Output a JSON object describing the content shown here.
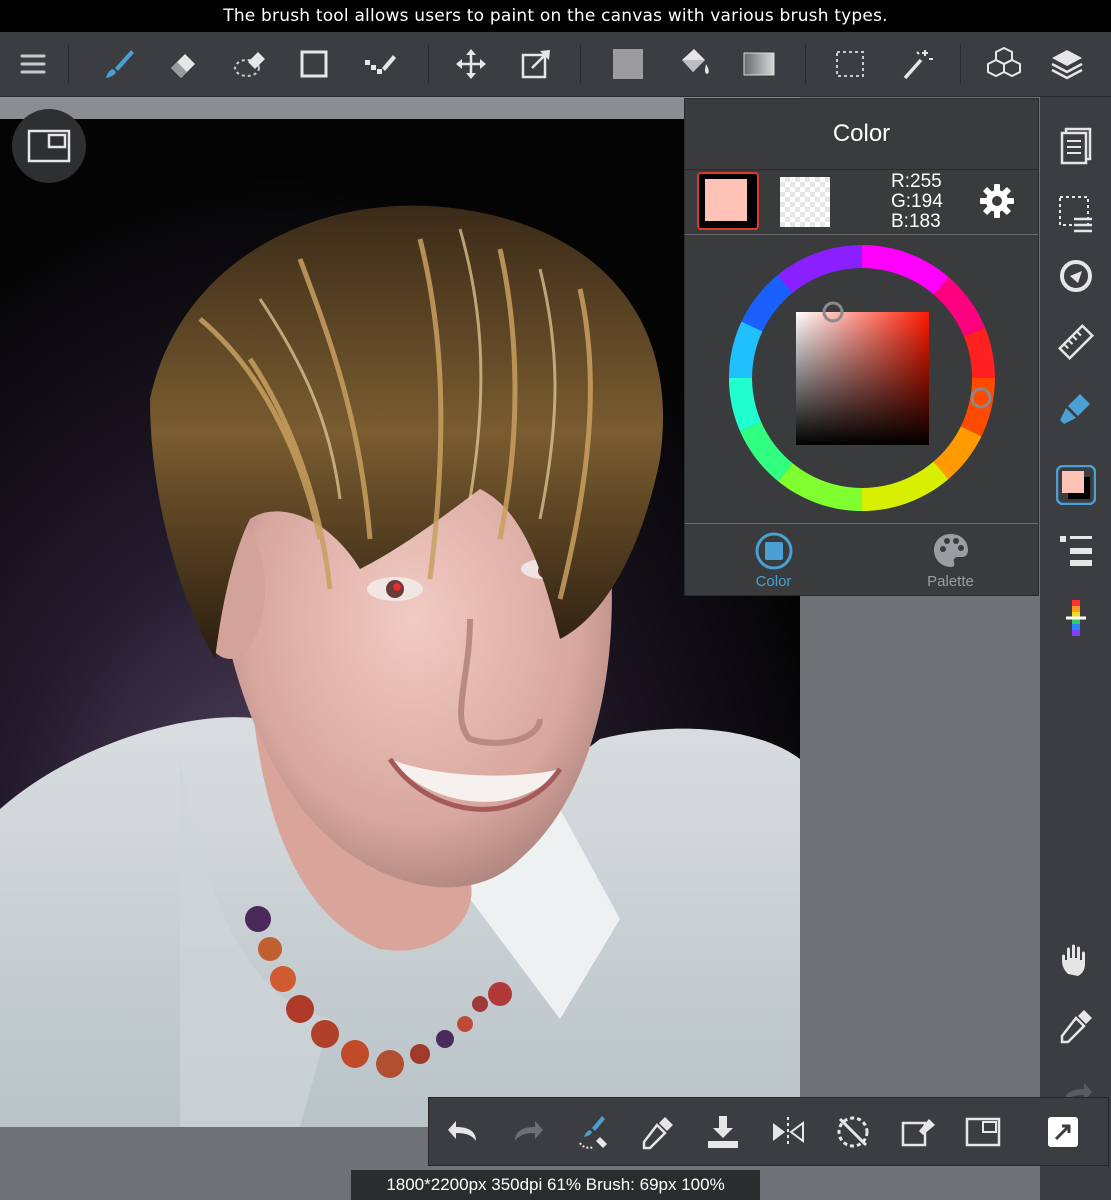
{
  "tooltip": "The brush tool allows users to paint on the canvas with various brush types.",
  "toolbar": {
    "tools": [
      "menu-icon",
      "brush-icon",
      "eraser-icon",
      "selection-eraser-icon",
      "rectangle-icon",
      "dot-line-icon",
      "move-icon",
      "transform-icon",
      "fill-color-icon",
      "bucket-icon",
      "gradient-icon",
      "select-rect-icon",
      "magic-wand-icon",
      "3d-icon",
      "layers-icon"
    ],
    "active_tool": "brush-icon"
  },
  "color_panel": {
    "title": "Color",
    "main_color": "#ffc2b7",
    "rgb": {
      "r": "R:255",
      "g": "G:194",
      "b": "B:183"
    },
    "tabs": [
      {
        "label": "Color",
        "active": true
      },
      {
        "label": "Palette",
        "active": false
      }
    ]
  },
  "right_bar": {
    "items": [
      "pages-icon",
      "selection-icon",
      "snap-icon",
      "ruler-icon",
      "brush-settings-icon",
      "color-swatch-icon",
      "layer-list-icon",
      "brush-palette-icon",
      "hand-icon",
      "eyedropper-icon",
      "redo-icon",
      "undo-icon"
    ]
  },
  "bottom_bar": {
    "items": [
      "undo-icon",
      "redo-icon",
      "brush-switch-icon",
      "eyedropper-icon",
      "save-icon",
      "flip-icon",
      "rotate-reset-icon",
      "transform-canvas-icon",
      "navigator-icon",
      "expand-icon"
    ]
  },
  "status": "1800*2200px 350dpi 61% Brush: 69px 100%",
  "colors": {
    "accent": "#4a9fd4",
    "panel_bg": "#3a3b3d",
    "toolbar_bg": "#3c3d40",
    "active_border": "#e03a2f"
  }
}
